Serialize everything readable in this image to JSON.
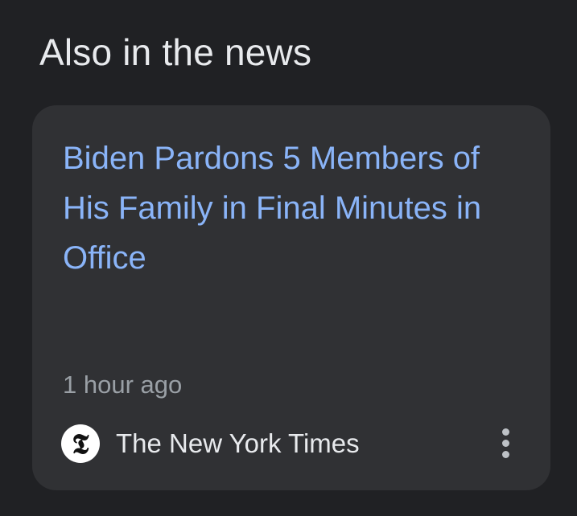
{
  "section": {
    "title": "Also in the news"
  },
  "article": {
    "headline": "Biden Pardons 5 Members of His Family in Final Minutes in Office",
    "timestamp": "1 hour ago",
    "source": {
      "name": "The New York Times",
      "logo_glyph": "𝕿",
      "logo_icon": "nyt-logo-icon"
    },
    "more_icon": "more-vert-icon"
  },
  "colors": {
    "background": "#202124",
    "card": "#303134",
    "headline": "#8ab4f8",
    "title": "#e8eaed",
    "secondary_text": "#9aa0a6"
  }
}
